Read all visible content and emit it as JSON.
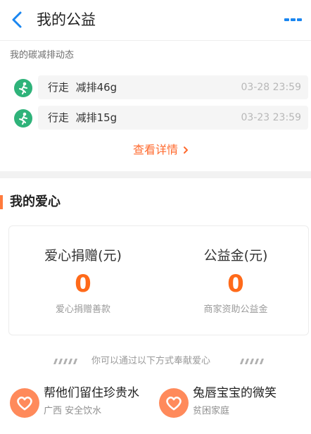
{
  "header": {
    "title": "我的公益",
    "back_icon": "chevron-left-icon",
    "more_icon": "more-dashes-icon",
    "accent_color": "#1a86f0"
  },
  "carbon": {
    "section_title": "我的碳减排动态",
    "records": [
      {
        "activity": "行走",
        "reduction": "减排46g",
        "time": "03-28 23:59",
        "icon": "walking-icon"
      },
      {
        "activity": "行走",
        "reduction": "减排15g",
        "time": "03-23 23:59",
        "icon": "walking-icon"
      }
    ],
    "details_link": "查看详情",
    "record_icon_color": "#2fb37a"
  },
  "love": {
    "section_title": "我的爱心",
    "stats": [
      {
        "label": "爱心捐赠(元)",
        "value": "0",
        "sub": "爱心捐赠善款"
      },
      {
        "label": "公益金(元)",
        "value": "0",
        "sub": "商家资助公益金"
      }
    ],
    "value_color": "#ff6a1a"
  },
  "ways": {
    "hint": "你可以通过以下方式奉献爱心",
    "items": [
      {
        "title": "帮他们留住珍贵水",
        "sub": "广西 安全饮水",
        "icon": "heart-icon"
      },
      {
        "title": "兔唇宝宝的微笑",
        "sub": "贫困家庭",
        "icon": "heart-icon"
      }
    ]
  }
}
